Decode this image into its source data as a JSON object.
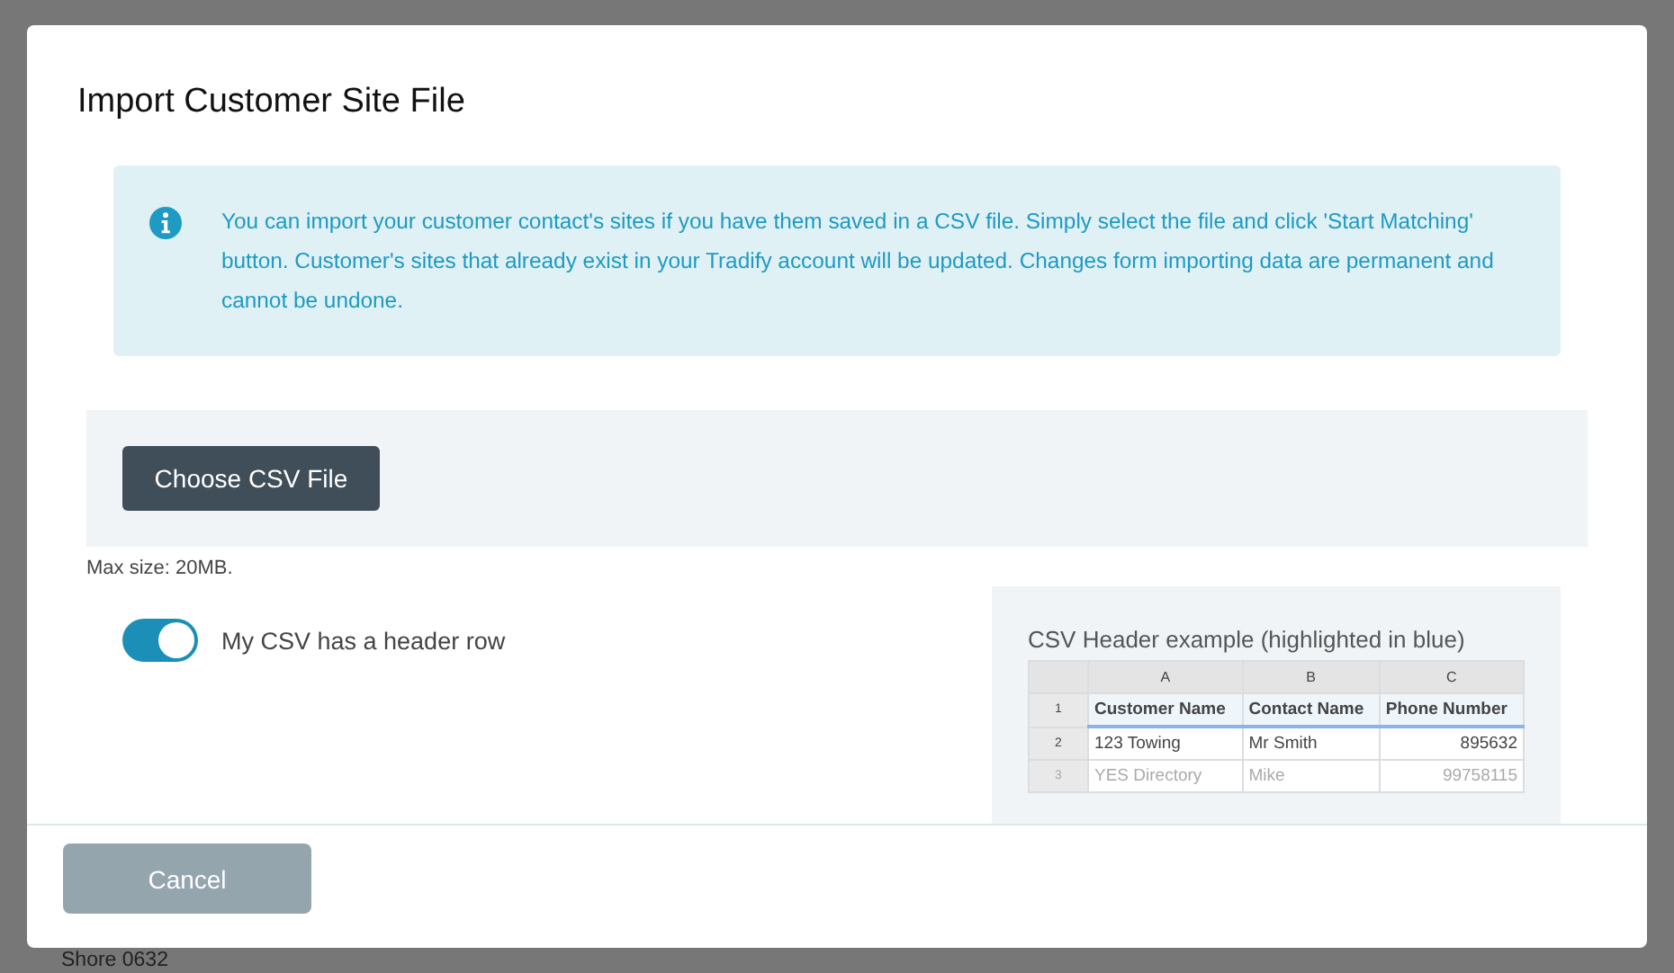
{
  "background": {
    "text": "Shore 0632"
  },
  "dialog": {
    "title": "Import Customer Site File",
    "info": "You can import your customer contact's sites if you have them saved in a CSV file. Simply select the file and click 'Start Matching' button. Customer's sites that already exist in your Tradify account will be updated. Changes form importing data are permanent and cannot be undone.",
    "choose_button": "Choose CSV File",
    "max_size": "Max size: 20MB.",
    "header_toggle": {
      "label": "My CSV has a header row",
      "on": true
    },
    "example": {
      "title": "CSV Header example (highlighted in blue)",
      "columns": [
        "A",
        "B",
        "C"
      ],
      "rows": [
        {
          "number": "1",
          "cells": [
            "Customer Name",
            "Contact Name",
            "Phone Number"
          ],
          "selected": true
        },
        {
          "number": "2",
          "cells": [
            "123 Towing",
            "Mr Smith",
            "895632"
          ],
          "selected": false
        },
        {
          "number": "3",
          "cells": [
            "YES Directory",
            "Mike",
            "99758115"
          ],
          "selected": false
        }
      ]
    },
    "buttons": [
      "Cancel"
    ]
  }
}
